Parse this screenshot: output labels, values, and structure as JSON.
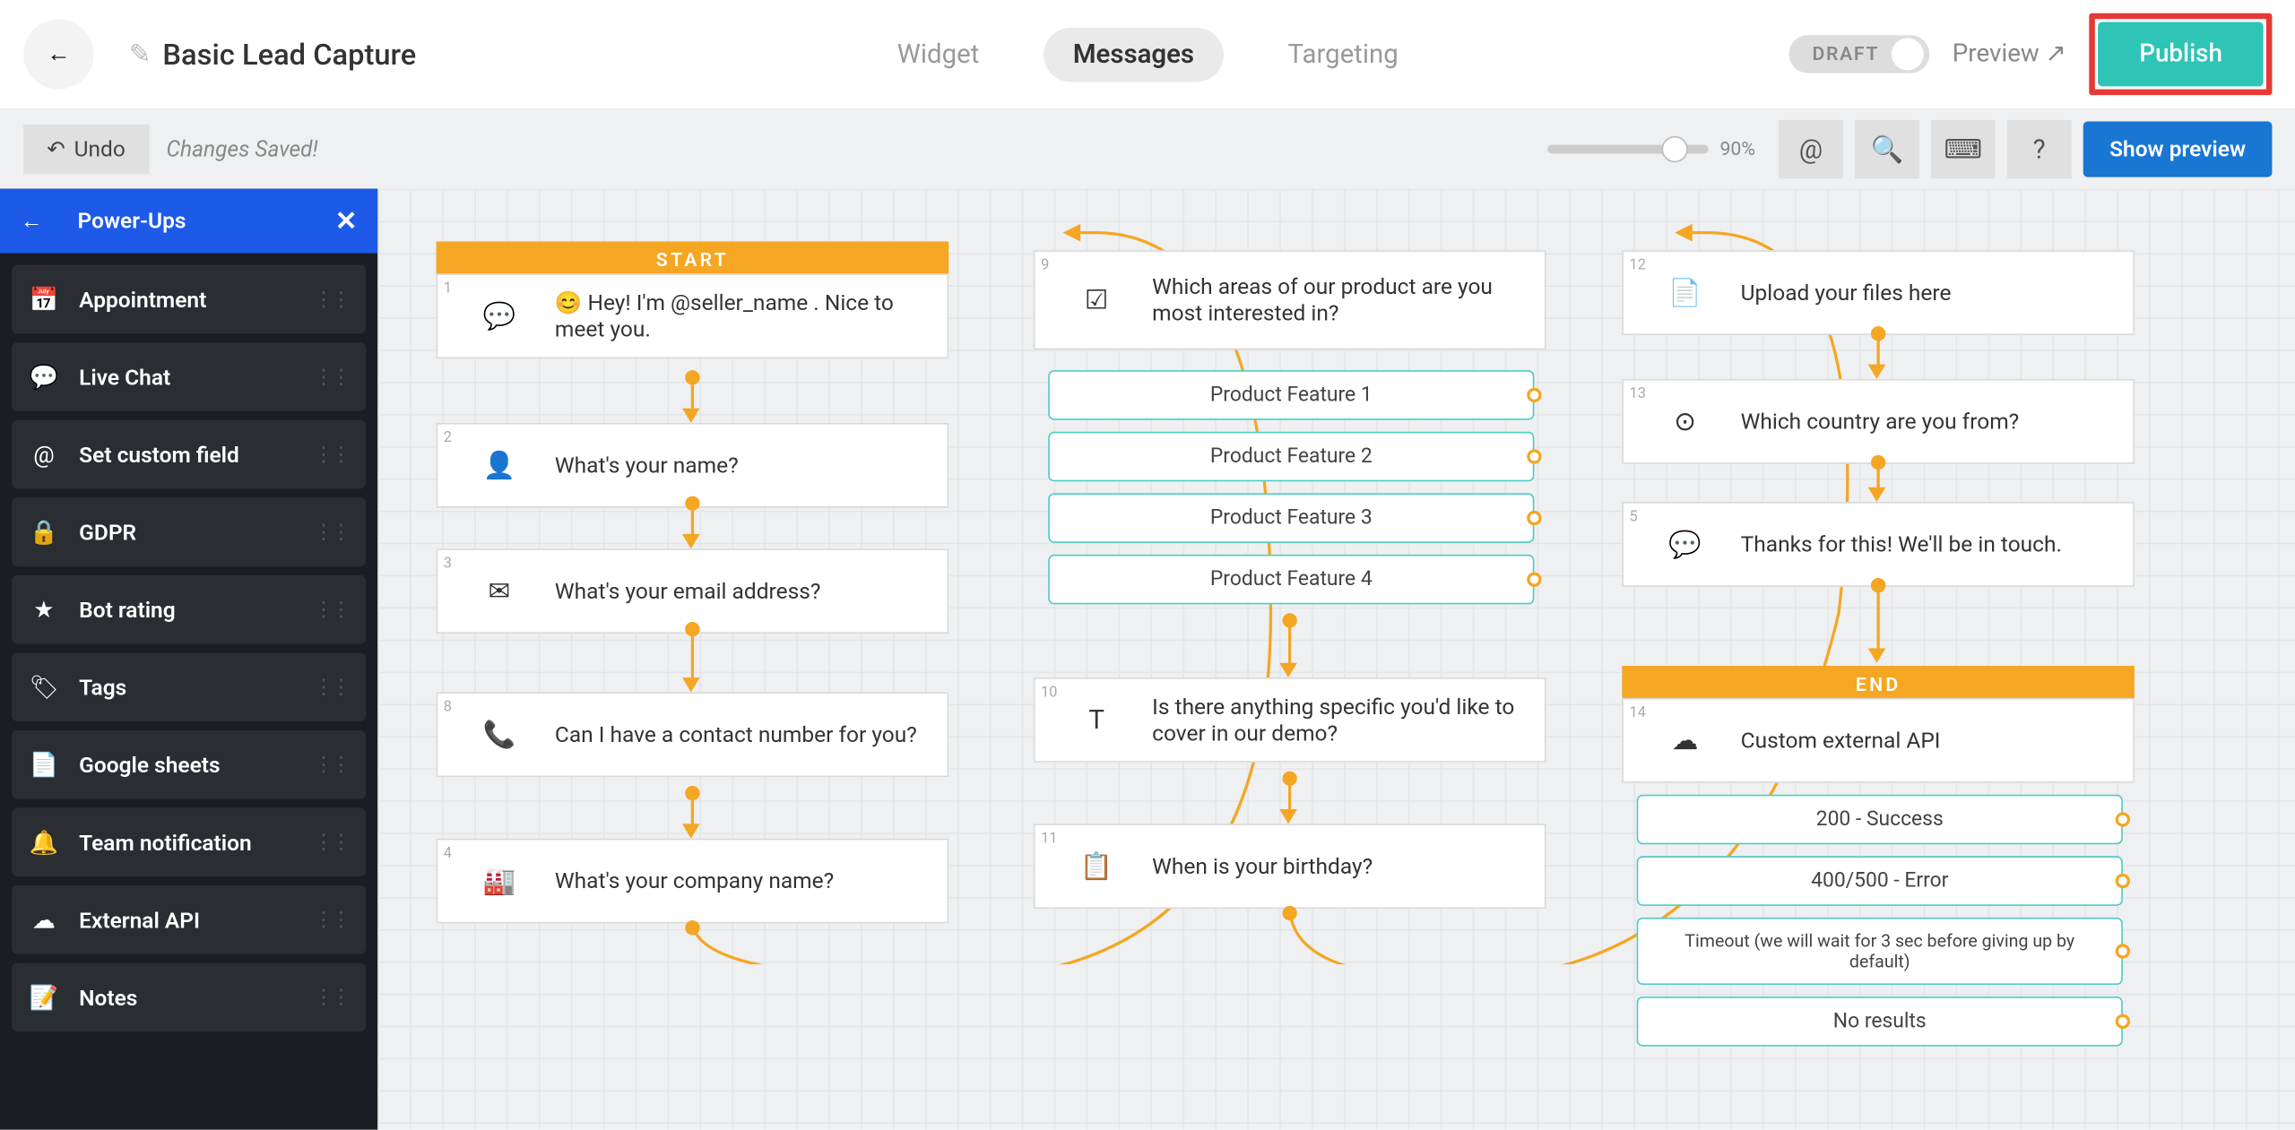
{
  "header": {
    "title": "Basic Lead Capture",
    "tabs": [
      "Widget",
      "Messages",
      "Targeting"
    ],
    "active_tab": 1,
    "draft_label": "DRAFT",
    "preview_label": "Preview",
    "publish_label": "Publish"
  },
  "toolbar": {
    "undo_label": "Undo",
    "saved_label": "Changes Saved!",
    "zoom_pct": "90%",
    "show_preview_label": "Show preview"
  },
  "sidebar": {
    "title": "Power-Ups",
    "items": [
      {
        "icon": "calendar",
        "label": "Appointment"
      },
      {
        "icon": "chat",
        "label": "Live Chat"
      },
      {
        "icon": "at",
        "label": "Set custom field"
      },
      {
        "icon": "lock",
        "label": "GDPR"
      },
      {
        "icon": "star",
        "label": "Bot rating"
      },
      {
        "icon": "tag",
        "label": "Tags"
      },
      {
        "icon": "sheet",
        "label": "Google sheets"
      },
      {
        "icon": "bell",
        "label": "Team notification"
      },
      {
        "icon": "cloud",
        "label": "External API"
      },
      {
        "icon": "note",
        "label": "Notes"
      }
    ]
  },
  "flow": {
    "start_label": "START",
    "end_label": "END",
    "col1": [
      {
        "num": "1",
        "icon": "speech",
        "text": "😊 Hey! I'm @seller_name . Nice to meet you."
      },
      {
        "num": "2",
        "icon": "person",
        "text": "What's your name?"
      },
      {
        "num": "3",
        "icon": "mail",
        "text": "What's your email address?"
      },
      {
        "num": "8",
        "icon": "phone",
        "text": "Can I have a contact number for you?"
      },
      {
        "num": "4",
        "icon": "industry",
        "text": "What's your company name?"
      }
    ],
    "col2_q1": {
      "num": "9",
      "icon": "list",
      "text": "Which areas of our product are you most interested in?"
    },
    "col2_options": [
      "Product Feature 1",
      "Product Feature 2",
      "Product Feature 3",
      "Product Feature 4"
    ],
    "col2_q2": {
      "num": "10",
      "icon": "text",
      "text": "Is there anything specific you'd like to cover in our demo?"
    },
    "col2_q3": {
      "num": "11",
      "icon": "date",
      "text": "When is your birthday?"
    },
    "col3": [
      {
        "num": "12",
        "icon": "file",
        "text": "Upload your files here"
      },
      {
        "num": "13",
        "icon": "expand",
        "text": "Which country are you from?"
      },
      {
        "num": "5",
        "icon": "speech",
        "text": "Thanks for this! We'll be in touch."
      }
    ],
    "col3_end": {
      "num": "14",
      "icon": "cloud",
      "text": "Custom external API"
    },
    "col3_end_options": [
      "200 - Success",
      "400/500 - Error",
      "Timeout (we will wait for 3 sec before giving up by default)",
      "No results"
    ]
  }
}
